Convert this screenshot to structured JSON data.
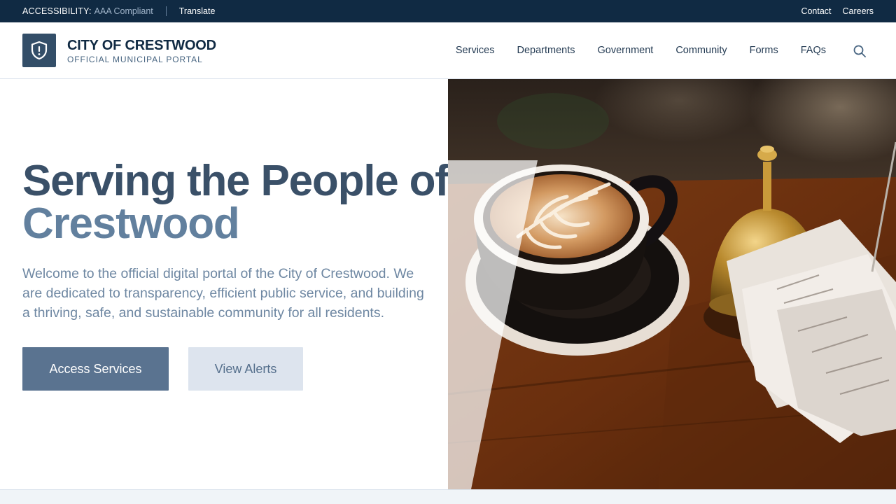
{
  "utility_bar": {
    "accessibility_label": "ACCESSIBILITY:",
    "accessibility_value": "AAA Compliant",
    "translate_label": "Translate",
    "links": [
      {
        "label": "Contact"
      },
      {
        "label": "Careers"
      }
    ]
  },
  "header": {
    "brand_name": "CITY OF CRESTWOOD",
    "brand_tagline": "OFFICIAL MUNICIPAL PORTAL",
    "logo_icon": "shield-alert-icon",
    "nav": [
      {
        "label": "Services"
      },
      {
        "label": "Departments"
      },
      {
        "label": "Government"
      },
      {
        "label": "Community"
      },
      {
        "label": "Forms"
      },
      {
        "label": "FAQs"
      }
    ],
    "search_icon": "search-icon"
  },
  "hero": {
    "title_line1": "Serving the People of",
    "title_line2": "Crestwood",
    "description": "Welcome to the official digital portal of the City of Crestwood. We are dedicated to transparency, efficient public service, and building a thriving, safe, and sustainable community for all residents.",
    "primary_button": "Access Services",
    "secondary_button": "View Alerts",
    "image_subject": "latte-art-coffee-cup-with-service-bell-and-receipts"
  },
  "colors": {
    "utility_bg": "#102a43",
    "brand": "#334e68",
    "primary_button": "#5a7390",
    "secondary_button": "#dde4ee"
  }
}
